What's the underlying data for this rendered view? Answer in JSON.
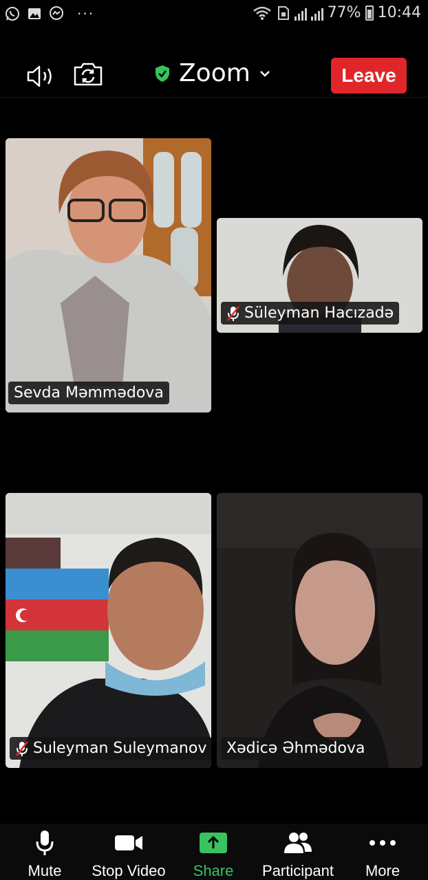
{
  "status_bar": {
    "battery": "77%",
    "time": "10:44",
    "more_dots": "···"
  },
  "toolbar": {
    "title": "Zoom",
    "leave_label": "Leave",
    "secure_color": "#36c45a",
    "leave_color": "#e0262b"
  },
  "participants": [
    {
      "name": "Sevda Məmmədova",
      "muted": false,
      "active_speaker": true
    },
    {
      "name": "Süleyman Hacızadə",
      "muted": true,
      "active_speaker": false
    },
    {
      "name": "Suleyman Suleymanov",
      "muted": true,
      "active_speaker": false
    },
    {
      "name": "Xədicə Əhmədova",
      "muted": false,
      "active_speaker": false
    }
  ],
  "bottom_bar": {
    "mute_label": "Mute",
    "stop_video_label": "Stop Video",
    "share_label": "Share",
    "participant_label": "Participant",
    "more_label": "More",
    "share_color": "#3ac261"
  },
  "icons": {
    "status_left": [
      "whatsapp-icon",
      "gallery-icon",
      "messenger-icon"
    ],
    "toolbar": [
      "speaker-icon",
      "switch-camera-icon",
      "shield-check-icon",
      "chevron-down-icon"
    ],
    "bottom": [
      "microphone-icon",
      "video-camera-icon",
      "share-arrow-icon",
      "participants-icon",
      "more-dots-icon"
    ]
  }
}
